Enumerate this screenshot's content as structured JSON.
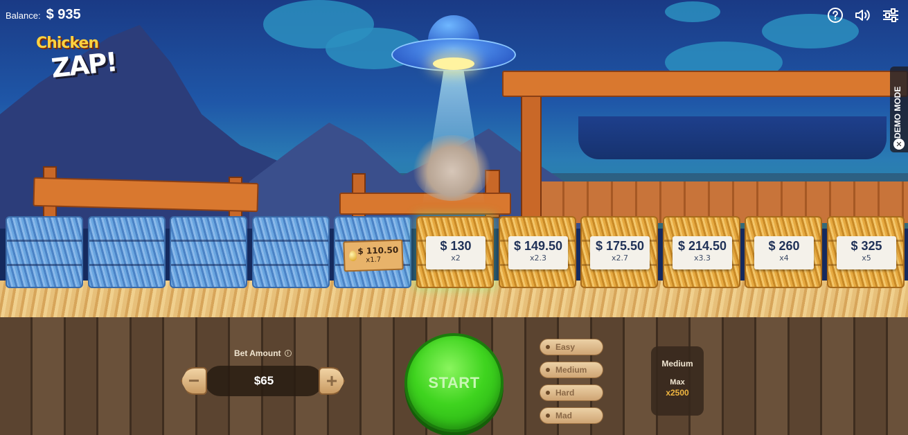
{
  "hud": {
    "balance_label": "Balance:",
    "balance_value": "$ 935",
    "logo_line1": "Chicken",
    "logo_line2": "ZAP!",
    "demo_mode": "DEMO MODE",
    "icons": [
      "help-icon",
      "sound-icon",
      "settings-sliders-icon",
      "close-icon"
    ]
  },
  "lanes": [
    {
      "state": "passed"
    },
    {
      "state": "passed"
    },
    {
      "state": "passed"
    },
    {
      "state": "passed"
    },
    {
      "state": "passed",
      "amount": "$ 110.50",
      "mult": "x1.7"
    },
    {
      "state": "current",
      "amount": "$ 130",
      "mult": "x2"
    },
    {
      "state": "upcoming",
      "amount": "$ 149.50",
      "mult": "x2.3"
    },
    {
      "state": "upcoming",
      "amount": "$ 175.50",
      "mult": "x2.7"
    },
    {
      "state": "upcoming",
      "amount": "$ 214.50",
      "mult": "x3.3"
    },
    {
      "state": "upcoming",
      "amount": "$ 260",
      "mult": "x4"
    },
    {
      "state": "upcoming",
      "amount": "$ 325",
      "mult": "x5"
    }
  ],
  "bet": {
    "label": "Bet Amount",
    "value": "$65",
    "minus": "−",
    "plus": "+"
  },
  "start_label": "START",
  "difficulty": {
    "options": [
      "Easy",
      "Medium",
      "Hard",
      "Mad"
    ],
    "selected": "Medium"
  },
  "info_panel": {
    "mode": "Medium",
    "max_label": "Max",
    "max_value": "x2500"
  },
  "colors": {
    "start_green": "#3fd41f",
    "max_gold": "#f0b640",
    "sign_text": "#1f3157",
    "bale_blue": "#4b83c6",
    "bale_gold": "#c98a27"
  }
}
